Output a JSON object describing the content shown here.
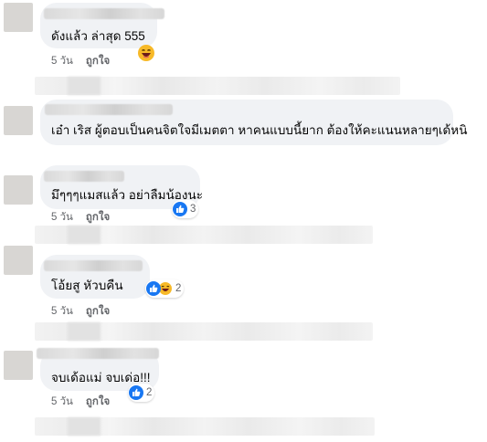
{
  "comments": [
    {
      "text": "ดังแล้ว ล่าสุด 555",
      "time": "5 วัน",
      "like_label": "ถูกใจ"
    },
    {
      "text": "เอ๋า เริส ผู้ตอบเป็นคนจิตใจมีเมตตา หาคนแบบนี้ยาก ต้องให้คะแนนหลายๆเด้หนิ"
    },
    {
      "text": "มึๆๆๆแมสแล้ว อย่าลืมน้องนะ",
      "time": "5 วัน",
      "like_label": "ถูกใจ",
      "reaction_count": "3"
    },
    {
      "text": "โอ้ยสู หัวบคืน",
      "time": "5 วัน",
      "like_label": "ถูกใจ",
      "reaction_count": "2"
    },
    {
      "text": "จบเด้อแม่ จบเด่อ!!!",
      "time": "5 วัน",
      "like_label": "ถูกใจ",
      "reaction_count": "2"
    }
  ],
  "colors": {
    "bubble": "#f0f2f5",
    "like_blue": "#1877f2",
    "haha_yellow": "#f7b928",
    "meta_gray": "#65676b"
  },
  "icons": [
    "like-reaction-icon",
    "haha-reaction-icon",
    "laughing-emoji-icon"
  ]
}
